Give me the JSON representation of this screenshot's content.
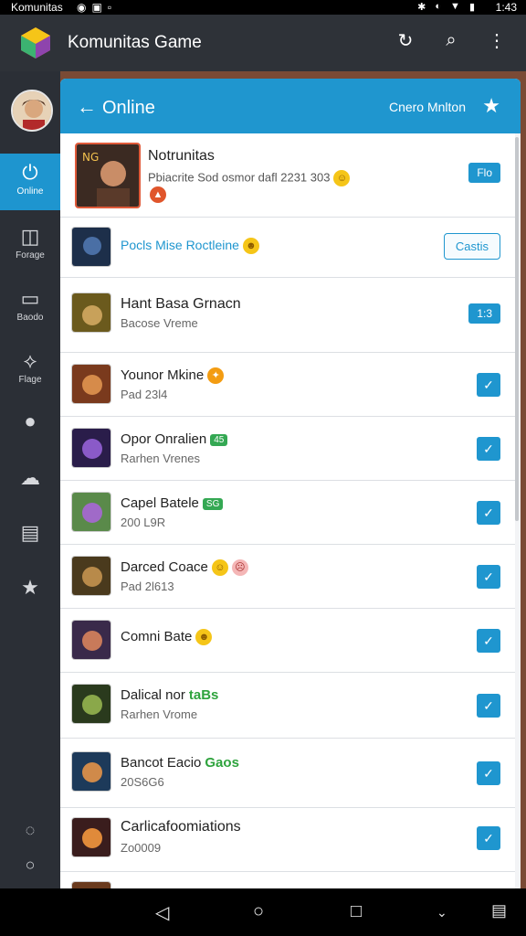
{
  "status_bar": {
    "title": "Komunitas",
    "time": "1:43"
  },
  "app": {
    "title": "Komunitas Game"
  },
  "rail": {
    "items": [
      {
        "label": "Online",
        "icon": "power-icon"
      },
      {
        "label": "Forage",
        "icon": "controller-icon"
      },
      {
        "label": "Baodo",
        "icon": "screen-icon"
      },
      {
        "label": "Flage",
        "icon": "share-icon"
      },
      {
        "label": "",
        "icon": "chat-icon"
      },
      {
        "label": "",
        "icon": "cloud-icon"
      },
      {
        "label": "",
        "icon": "document-icon"
      },
      {
        "label": "",
        "icon": "star-icon"
      }
    ]
  },
  "panel": {
    "title": "Online",
    "subtitle": "Cnero Mnlton"
  },
  "rows": [
    {
      "name": "Notrunitas",
      "meta": "Pbiacrite Sod osmor dafl 2231 303",
      "action": "Flo"
    },
    {
      "name": "Pocls Mise Roctleine",
      "meta": "",
      "action": "Castis"
    },
    {
      "name": "Hant Basa Grnacn",
      "meta": "Bacose Vreme",
      "action": "1:3"
    },
    {
      "name": "Younor Mkine",
      "meta": "Pad 23l4",
      "action": "check"
    },
    {
      "name": "Opor Onralien",
      "meta": "Rarhen Vrenes",
      "badge": "45",
      "action": "check"
    },
    {
      "name": "Capel Batele",
      "meta": "200 L9R",
      "badge": "SG",
      "action": "check"
    },
    {
      "name": "Darced Coace",
      "meta": "Pad 2l613",
      "action": "check"
    },
    {
      "name": "Comni Bate",
      "meta": "",
      "action": "check"
    },
    {
      "name": "Dalical nor",
      "meta": "Rarhen Vrome",
      "tag": "taBs",
      "action": "check"
    },
    {
      "name": "Bancot Eacio",
      "meta": "20S6G6",
      "tag": "Gaos",
      "action": "check"
    },
    {
      "name": "Carlicafoomiations",
      "meta": "Zo0009",
      "action": "check"
    }
  ],
  "colors": {
    "accent": "#1f96cf",
    "rail": "#2b2f36",
    "green": "#34a853"
  }
}
